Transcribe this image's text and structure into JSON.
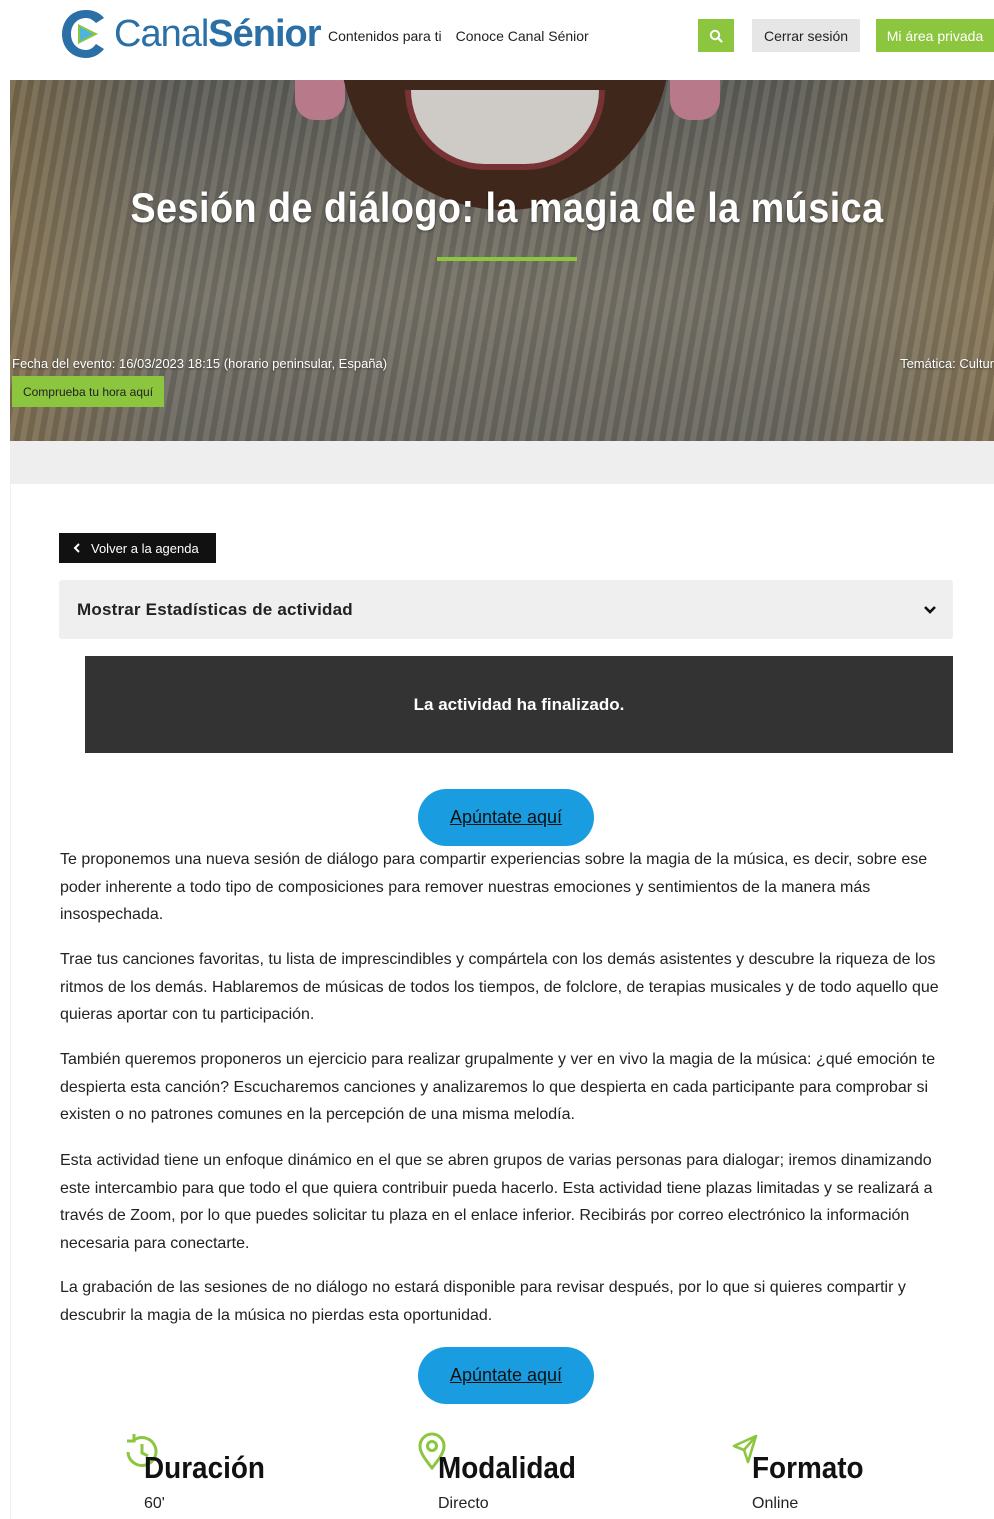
{
  "header": {
    "logo_part1": "Canal",
    "logo_part2": "Sénior",
    "nav": [
      "Contenidos para ti",
      "Conoce Canal Sénior"
    ],
    "logout_label": "Cerrar sesión",
    "private_label": "Mi área privada",
    "accent_color": "#8cc63f"
  },
  "hero": {
    "title": "Sesión de diálogo: la magia de la música",
    "event_date": "Fecha del evento: 16/03/2023 18:15 (horario peninsular, España)",
    "theme": "Temática: Cultur",
    "check_time_label": "Comprueba tu hora aquí"
  },
  "actions": {
    "back_label": "Volver a la agenda",
    "stats_label": "Mostrar Estadísticas de actividad",
    "ended_message": "La actividad ha finalizado.",
    "signup_label": "Apúntate aquí",
    "signup_color": "#199de0"
  },
  "description": [
    "Te proponemos una nueva sesión de diálogo para compartir experiencias sobre la magia de la música, es decir, sobre ese poder inherente a todo tipo de composiciones para remover nuestras emociones y sentimientos de la manera más insospechada.",
    "Trae tus canciones favoritas, tu lista de imprescindibles y compártela con los demás asistentes y descubre la riqueza de los ritmos de los demás. Hablaremos de músicas de todos los tiempos, de folclore, de terapias musicales y de todo aquello que quieras aportar con tu participación.",
    "También queremos proponeros un ejercicio para realizar grupalmente y ver en vivo la magia de la música: ¿qué emoción te despierta esta canción? Escucharemos canciones y analizaremos lo que despierta en cada participante para comprobar si existen o no patrones comunes en la percepción de una misma melodía.",
    "Esta actividad tiene un enfoque dinámico en el que se abren grupos de varias personas para dialogar; iremos dinamizando este intercambio para que todo el que quiera contribuir pueda hacerlo. Esta actividad tiene plazas limitadas y se realizará a través de Zoom, por lo que puedes solicitar tu plaza en el enlace inferior. Recibirás por correo electrónico la información necesaria para conectarte.",
    "La grabación de las sesiones de no diálogo no estará disponible para revisar después, por lo que si quieres compartir y descubrir la magia de la música no pierdas esta oportunidad."
  ],
  "features": [
    {
      "icon": "clock-icon",
      "title": "Duración",
      "value": "60'"
    },
    {
      "icon": "location-pin-icon",
      "title": "Modalidad",
      "value": "Directo"
    },
    {
      "icon": "paper-plane-icon",
      "title": "Formato",
      "value": "Online"
    }
  ]
}
